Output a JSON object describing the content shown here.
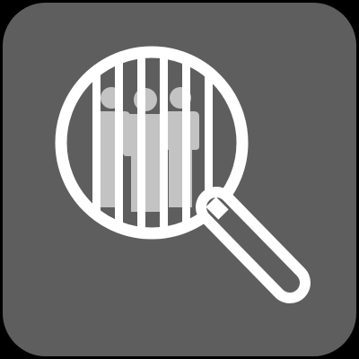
{
  "icon": {
    "name": "inmate-search-icon",
    "depicts": [
      "magnifying-glass",
      "prison-bars",
      "group-of-people"
    ]
  },
  "colors": {
    "page_background": "#000000",
    "tile_background": "#5e5e5e",
    "glass_and_bars": "#ffffff",
    "people": "#c3c3c3"
  }
}
